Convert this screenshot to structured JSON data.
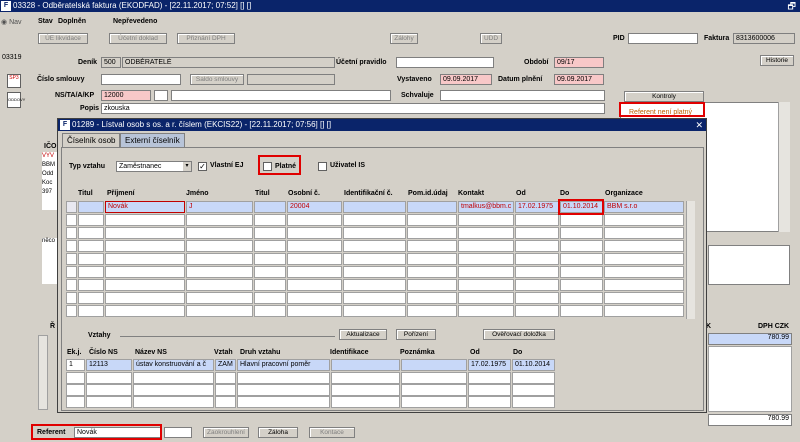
{
  "window": {
    "title": "03328 - Odběratelská faktura (EKODFAD) - [22.11.2017; 07:52] [] []",
    "restore": "🗗"
  },
  "sidebar": {
    "nav": "Nav",
    "id1": "03319",
    "icons": [
      "SP3",
      "ODDOVY"
    ]
  },
  "header": {
    "stav_label": "Stav",
    "stav_value": "Doplněn",
    "neprevedeno": "Nepřevedeno",
    "buttons": {
      "ue_likvidace": "ÚE likvidace",
      "ucetni_doklad": "Účetní doklad",
      "priznani_dph": "Přiznání DPH",
      "zalohy": "Zálohy",
      "udd": "UDD",
      "kontroly": "Kontroly",
      "historie": "Historie"
    },
    "pid_label": "PID",
    "pid_value": "",
    "faktura_label": "Faktura",
    "faktura_value": "8313600006"
  },
  "form": {
    "denik_label": "Deník",
    "denik_code": "500",
    "denik_name": "ODBĚRATELÉ",
    "ucetni_pravidlo_label": "Účetní pravidlo",
    "obdobi_label": "Období",
    "obdobi_value": "09/17",
    "cislo_smlouvy_label": "Číslo smlouvy",
    "saldo_smlouvy": "Saldo smlouvy",
    "vystaveno_label": "Vystaveno",
    "vystaveno_value": "09.09.2017",
    "datum_plneni_label": "Datum plnění",
    "datum_plneni_value": "09.09.2017",
    "ns_label": "NS/TA/A/KP",
    "ns_value": "12000",
    "schvaluje_label": "Schvaluje",
    "popis_label": "Popis",
    "popis_value": "zkouska",
    "referent_error": "Referent není platný",
    "ico_label": "IČO",
    "left_snips": [
      "VYV",
      "BBM",
      "Odd",
      "Koc",
      "397"
    ],
    "neco": "něco",
    "r_label": "Ř",
    "k_label": "K",
    "dph_czk_label": "DPH CZK",
    "dph_value": "780.99",
    "total_value": "780.99",
    "referent_label": "Referent",
    "referent_value": "Novák",
    "zaokrouhleni": "Zaokrouhlení",
    "zaloha": "Záloha",
    "kontace": "Kontace"
  },
  "modal": {
    "title": "01289 - Lístval osob s os. a r. číslem (EKCIS22) - [22.11.2017; 07:56] [] []",
    "tabs": [
      "Číselník osob",
      "Externí číselník"
    ],
    "typ_vztahu_label": "Typ vztahu",
    "typ_vztahu_value": "Zaměstnanec",
    "vlastni_ej": "Vlastní EJ",
    "platne": "Platné",
    "uzivatel_is": "Uživatel IS",
    "columns": [
      "Titul",
      "Příjmení",
      "Jméno",
      "Titul",
      "Osobní č.",
      "Identifikační č.",
      "Pom.id.údaj",
      "Kontakt",
      "Od",
      "Do",
      "Organizace"
    ],
    "row": {
      "prijmeni": "Novák",
      "jmeno": "J",
      "osobni": "20004",
      "kontakt": "tmalkus@bbm.c",
      "od": "17.02.1975",
      "do": "01.10.2014",
      "organizace": "BBM s.r.o"
    },
    "vztahy_label": "Vztahy",
    "aktualizace": "Aktualizace",
    "porizeni": "Pořízení",
    "overovaci": "Ověřovací doložka",
    "vcols": [
      "Ek.j.",
      "Číslo NS",
      "Název NS",
      "Vztah",
      "Druh vztahu",
      "Identifikace",
      "Poznámka",
      "Od",
      "Do"
    ],
    "vrow": {
      "ekj": "1",
      "cislo_ns": "12113",
      "nazev_ns": "ústav konstruování a č",
      "vztah": "ZAM",
      "druh": "Hlavní pracovní poměr",
      "od": "17.02.1975",
      "do": "01.10.2014"
    }
  }
}
